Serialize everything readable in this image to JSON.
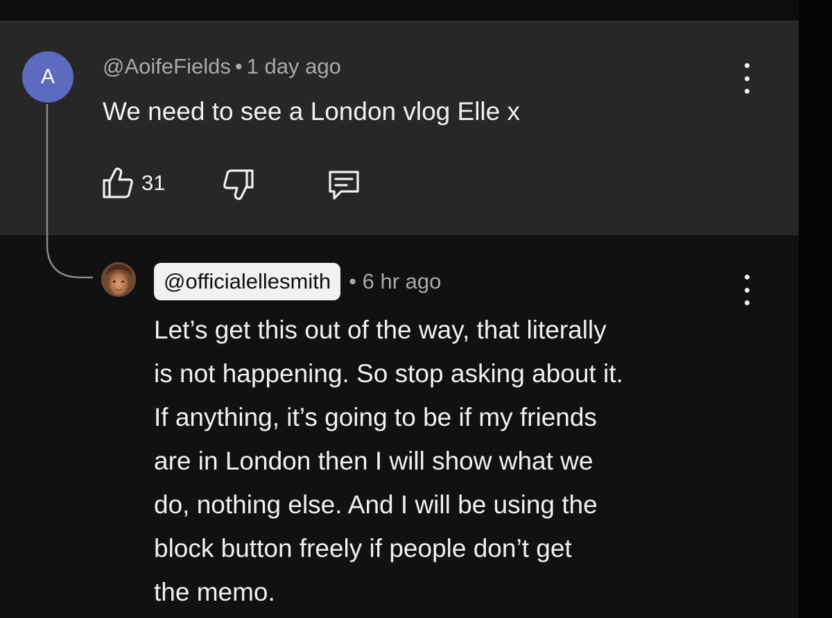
{
  "parent_comment": {
    "avatar_letter": "A",
    "avatar_color": "#5c6bc0",
    "author": "@AoifeFields",
    "separator": "•",
    "time": "1 day ago",
    "text": "We need to see a London vlog Elle x",
    "like_count": "31",
    "icons": [
      "thumbs-up-icon",
      "thumbs-down-icon",
      "reply-comment-icon",
      "more-vert-icon"
    ]
  },
  "reply": {
    "author": "@officialellesmith",
    "separator": "•",
    "time": "6 hr ago",
    "text_lines": [
      "Let’s get this out of the way, that literally",
      "is not happening. So stop asking about it.",
      "If anything, it’s going to be if my friends",
      "are in London then I will show what we",
      "do, nothing else. And I will be using the",
      "block button freely if people don’t get",
      "the memo."
    ],
    "icons": [
      "profile-photo",
      "more-vert-icon"
    ]
  },
  "colors": {
    "parent_background": "#272727",
    "reply_background": "#111111",
    "text_primary": "#f1f1f1",
    "text_secondary": "#aaaaaa"
  }
}
